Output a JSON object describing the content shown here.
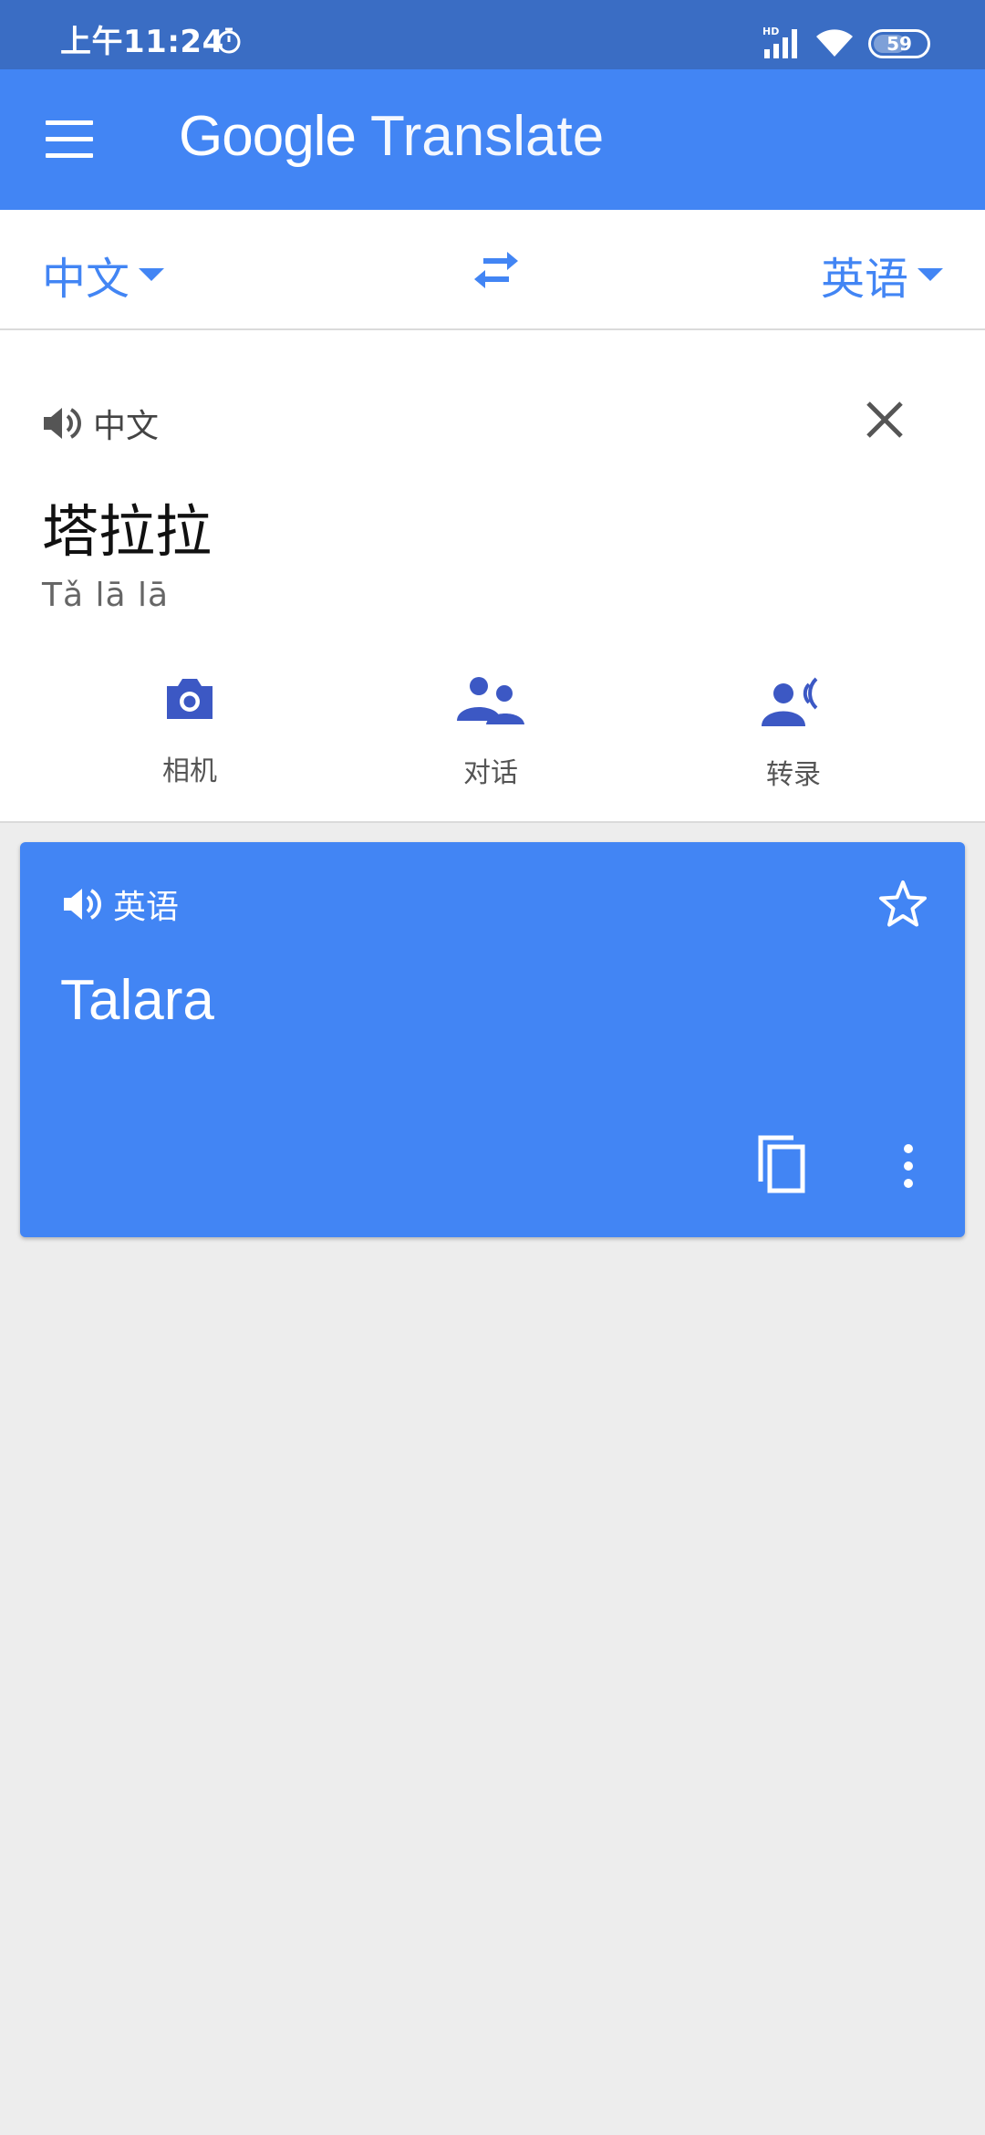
{
  "status_bar": {
    "time": "上午11:24",
    "battery": "59",
    "network_label": "HD"
  },
  "app_bar": {
    "title_brand": "Google",
    "title_product": "Translate"
  },
  "language_bar": {
    "source_language": "中文",
    "target_language": "英语"
  },
  "input": {
    "language_label": "中文",
    "text": "塔拉拉",
    "transliteration": "Tǎ lā lā",
    "tools": [
      {
        "label": "相机",
        "icon": "camera-icon"
      },
      {
        "label": "对话",
        "icon": "conversation-icon"
      },
      {
        "label": "转录",
        "icon": "transcribe-icon"
      }
    ]
  },
  "result": {
    "language_label": "英语",
    "text": "Talara"
  },
  "colors": {
    "status_bar": "#3a6dc4",
    "brand_blue": "#4285f4",
    "tool_icon": "#3c58c4",
    "background": "#ededed"
  }
}
